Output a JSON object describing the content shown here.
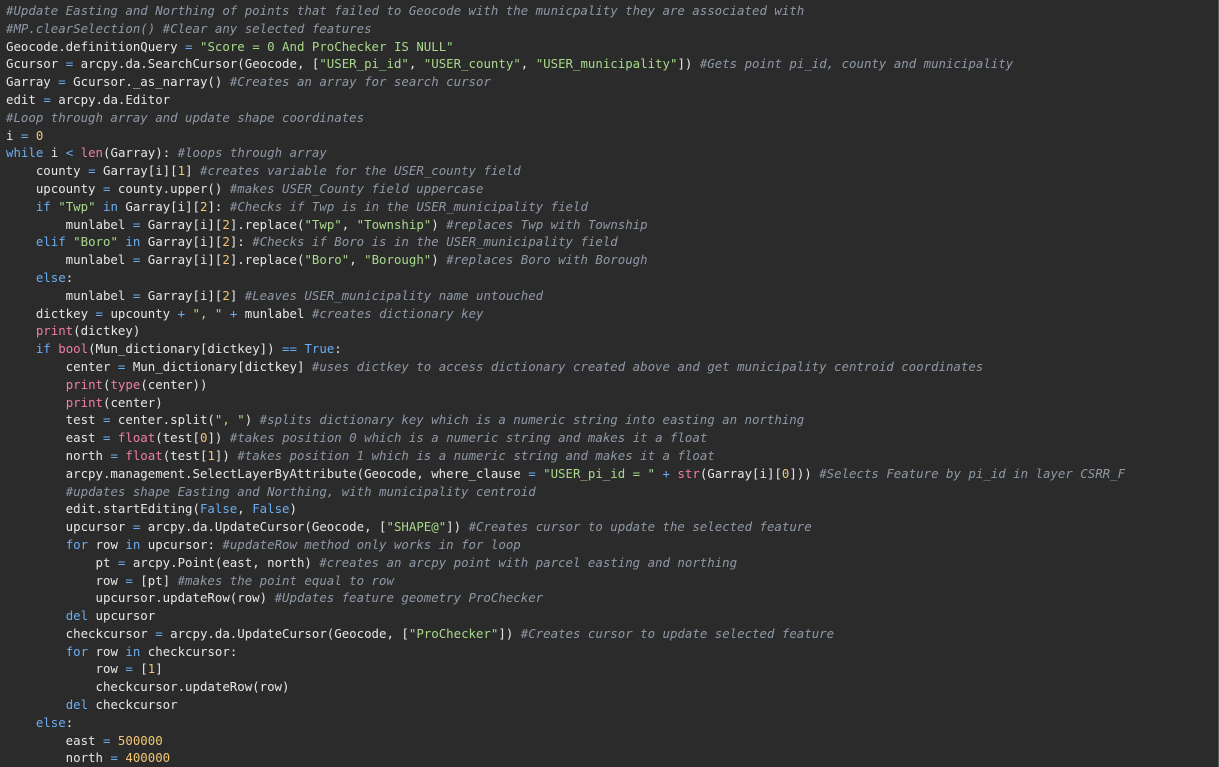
{
  "colors": {
    "background": "#2b2b2b",
    "text": "#e6e6e6",
    "comment": "#8f98a6",
    "string": "#a8d98a",
    "keyword": "#6aaef2",
    "builtin": "#ef7ea8",
    "number": "#f0c674",
    "operator": "#6aaef2"
  },
  "editor": {
    "lines": [
      [
        [
          "comment",
          "#Update Easting and Northing of points that failed to Geocode with the municpality they are associated with"
        ]
      ],
      [
        [
          "comment",
          "#MP.clearSelection() #Clear any selected features"
        ]
      ],
      [
        [
          "text",
          "Geocode.definitionQuery "
        ],
        [
          "operator",
          "="
        ],
        [
          "text",
          " "
        ],
        [
          "string",
          "\"Score = 0 And ProChecker IS NULL\""
        ]
      ],
      [
        [
          "text",
          "Gcursor "
        ],
        [
          "operator",
          "="
        ],
        [
          "text",
          " arcpy.da.SearchCursor(Geocode, ["
        ],
        [
          "string",
          "\"USER_pi_id\""
        ],
        [
          "text",
          ", "
        ],
        [
          "string",
          "\"USER_county\""
        ],
        [
          "text",
          ", "
        ],
        [
          "string",
          "\"USER_municipality\""
        ],
        [
          "text",
          "]) "
        ],
        [
          "comment",
          "#Gets point pi_id, county and municipality"
        ]
      ],
      [
        [
          "text",
          "Garray "
        ],
        [
          "operator",
          "="
        ],
        [
          "text",
          " Gcursor._as_narray() "
        ],
        [
          "comment",
          "#Creates an array for search cursor"
        ]
      ],
      [
        [
          "text",
          "edit "
        ],
        [
          "operator",
          "="
        ],
        [
          "text",
          " arcpy.da.Editor"
        ]
      ],
      [
        [
          "comment",
          "#Loop through array and update shape coordinates"
        ]
      ],
      [
        [
          "text",
          "i "
        ],
        [
          "operator",
          "="
        ],
        [
          "text",
          " "
        ],
        [
          "number",
          "0"
        ]
      ],
      [
        [
          "keyword",
          "while"
        ],
        [
          "text",
          " i "
        ],
        [
          "operator",
          "<"
        ],
        [
          "text",
          " "
        ],
        [
          "builtin",
          "len"
        ],
        [
          "text",
          "(Garray): "
        ],
        [
          "comment",
          "#loops through array"
        ]
      ],
      [
        [
          "text",
          "    county "
        ],
        [
          "operator",
          "="
        ],
        [
          "text",
          " Garray[i]["
        ],
        [
          "number",
          "1"
        ],
        [
          "text",
          "] "
        ],
        [
          "comment",
          "#creates variable for the USER_county field"
        ]
      ],
      [
        [
          "text",
          "    upcounty "
        ],
        [
          "operator",
          "="
        ],
        [
          "text",
          " county.upper() "
        ],
        [
          "comment",
          "#makes USER_County field uppercase"
        ]
      ],
      [
        [
          "text",
          "    "
        ],
        [
          "keyword",
          "if"
        ],
        [
          "text",
          " "
        ],
        [
          "string",
          "\"Twp\""
        ],
        [
          "text",
          " "
        ],
        [
          "keyword",
          "in"
        ],
        [
          "text",
          " Garray[i]["
        ],
        [
          "number",
          "2"
        ],
        [
          "text",
          "]: "
        ],
        [
          "comment",
          "#Checks if Twp is in the USER_municipality field"
        ]
      ],
      [
        [
          "text",
          "        munlabel "
        ],
        [
          "operator",
          "="
        ],
        [
          "text",
          " Garray[i]["
        ],
        [
          "number",
          "2"
        ],
        [
          "text",
          "].replace("
        ],
        [
          "string",
          "\"Twp\""
        ],
        [
          "text",
          ", "
        ],
        [
          "string",
          "\"Township\""
        ],
        [
          "text",
          ") "
        ],
        [
          "comment",
          "#replaces Twp with Township"
        ]
      ],
      [
        [
          "text",
          "    "
        ],
        [
          "keyword",
          "elif"
        ],
        [
          "text",
          " "
        ],
        [
          "string",
          "\"Boro\""
        ],
        [
          "text",
          " "
        ],
        [
          "keyword",
          "in"
        ],
        [
          "text",
          " Garray[i]["
        ],
        [
          "number",
          "2"
        ],
        [
          "text",
          "]: "
        ],
        [
          "comment",
          "#Checks if Boro is in the USER_municipality field"
        ]
      ],
      [
        [
          "text",
          "        munlabel "
        ],
        [
          "operator",
          "="
        ],
        [
          "text",
          " Garray[i]["
        ],
        [
          "number",
          "2"
        ],
        [
          "text",
          "].replace("
        ],
        [
          "string",
          "\"Boro\""
        ],
        [
          "text",
          ", "
        ],
        [
          "string",
          "\"Borough\""
        ],
        [
          "text",
          ") "
        ],
        [
          "comment",
          "#replaces Boro with Borough"
        ]
      ],
      [
        [
          "text",
          "    "
        ],
        [
          "keyword",
          "else"
        ],
        [
          "text",
          ":"
        ]
      ],
      [
        [
          "text",
          "        munlabel "
        ],
        [
          "operator",
          "="
        ],
        [
          "text",
          " Garray[i]["
        ],
        [
          "number",
          "2"
        ],
        [
          "text",
          "] "
        ],
        [
          "comment",
          "#Leaves USER_municipality name untouched"
        ]
      ],
      [
        [
          "text",
          "    dictkey "
        ],
        [
          "operator",
          "="
        ],
        [
          "text",
          " upcounty "
        ],
        [
          "operator",
          "+"
        ],
        [
          "text",
          " "
        ],
        [
          "string",
          "\", \""
        ],
        [
          "text",
          " "
        ],
        [
          "operator",
          "+"
        ],
        [
          "text",
          " munlabel "
        ],
        [
          "comment",
          "#creates dictionary key"
        ]
      ],
      [
        [
          "text",
          "    "
        ],
        [
          "builtin",
          "print"
        ],
        [
          "text",
          "(dictkey)"
        ]
      ],
      [
        [
          "text",
          "    "
        ],
        [
          "keyword",
          "if"
        ],
        [
          "text",
          " "
        ],
        [
          "builtin",
          "bool"
        ],
        [
          "text",
          "(Mun_dictionary[dictkey]) "
        ],
        [
          "operator",
          "=="
        ],
        [
          "text",
          " "
        ],
        [
          "keyword",
          "True"
        ],
        [
          "text",
          ":"
        ]
      ],
      [
        [
          "text",
          "        center "
        ],
        [
          "operator",
          "="
        ],
        [
          "text",
          " Mun_dictionary[dictkey] "
        ],
        [
          "comment",
          "#uses dictkey to access dictionary created above and get municipality centroid coordinates"
        ]
      ],
      [
        [
          "text",
          "        "
        ],
        [
          "builtin",
          "print"
        ],
        [
          "text",
          "("
        ],
        [
          "builtin",
          "type"
        ],
        [
          "text",
          "(center))"
        ]
      ],
      [
        [
          "text",
          "        "
        ],
        [
          "builtin",
          "print"
        ],
        [
          "text",
          "(center)"
        ]
      ],
      [
        [
          "text",
          "        test "
        ],
        [
          "operator",
          "="
        ],
        [
          "text",
          " center.split("
        ],
        [
          "string",
          "\", \""
        ],
        [
          "text",
          ") "
        ],
        [
          "comment",
          "#splits dictionary key which is a numeric string into easting an northing"
        ]
      ],
      [
        [
          "text",
          "        east "
        ],
        [
          "operator",
          "="
        ],
        [
          "text",
          " "
        ],
        [
          "builtin",
          "float"
        ],
        [
          "text",
          "(test["
        ],
        [
          "number",
          "0"
        ],
        [
          "text",
          "]) "
        ],
        [
          "comment",
          "#takes position 0 which is a numeric string and makes it a float"
        ]
      ],
      [
        [
          "text",
          "        north "
        ],
        [
          "operator",
          "="
        ],
        [
          "text",
          " "
        ],
        [
          "builtin",
          "float"
        ],
        [
          "text",
          "(test["
        ],
        [
          "number",
          "1"
        ],
        [
          "text",
          "]) "
        ],
        [
          "comment",
          "#takes position 1 which is a numeric string and makes it a float"
        ]
      ],
      [
        [
          "text",
          "        arcpy.management.SelectLayerByAttribute(Geocode, where_clause "
        ],
        [
          "operator",
          "="
        ],
        [
          "text",
          " "
        ],
        [
          "string",
          "\"USER_pi_id = \""
        ],
        [
          "text",
          " "
        ],
        [
          "operator",
          "+"
        ],
        [
          "text",
          " "
        ],
        [
          "builtin",
          "str"
        ],
        [
          "text",
          "(Garray[i]["
        ],
        [
          "number",
          "0"
        ],
        [
          "text",
          "])) "
        ],
        [
          "comment",
          "#Selects Feature by pi_id in layer CSRR_F"
        ]
      ],
      [
        [
          "text",
          "        "
        ],
        [
          "comment",
          "#updates shape Easting and Northing, with municipality centroid"
        ]
      ],
      [
        [
          "text",
          "        edit.startEditing("
        ],
        [
          "keyword",
          "False"
        ],
        [
          "text",
          ", "
        ],
        [
          "keyword",
          "False"
        ],
        [
          "text",
          ")"
        ]
      ],
      [
        [
          "text",
          "        upcursor "
        ],
        [
          "operator",
          "="
        ],
        [
          "text",
          " arcpy.da.UpdateCursor(Geocode, ["
        ],
        [
          "string",
          "\"SHAPE@\""
        ],
        [
          "text",
          "]) "
        ],
        [
          "comment",
          "#Creates cursor to update the selected feature"
        ]
      ],
      [
        [
          "text",
          "        "
        ],
        [
          "keyword",
          "for"
        ],
        [
          "text",
          " row "
        ],
        [
          "keyword",
          "in"
        ],
        [
          "text",
          " upcursor: "
        ],
        [
          "comment",
          "#updateRow method only works in for loop"
        ]
      ],
      [
        [
          "text",
          "            pt "
        ],
        [
          "operator",
          "="
        ],
        [
          "text",
          " arcpy.Point(east, north) "
        ],
        [
          "comment",
          "#creates an arcpy point with parcel easting and northing"
        ]
      ],
      [
        [
          "text",
          "            row "
        ],
        [
          "operator",
          "="
        ],
        [
          "text",
          " [pt] "
        ],
        [
          "comment",
          "#makes the point equal to row"
        ]
      ],
      [
        [
          "text",
          "            upcursor.updateRow(row) "
        ],
        [
          "comment",
          "#Updates feature geometry ProChecker"
        ]
      ],
      [
        [
          "text",
          "        "
        ],
        [
          "keyword",
          "del"
        ],
        [
          "text",
          " upcursor"
        ]
      ],
      [
        [
          "text",
          "        checkcursor "
        ],
        [
          "operator",
          "="
        ],
        [
          "text",
          " arcpy.da.UpdateCursor(Geocode, ["
        ],
        [
          "string",
          "\"ProChecker\""
        ],
        [
          "text",
          "]) "
        ],
        [
          "comment",
          "#Creates cursor to update selected feature"
        ]
      ],
      [
        [
          "text",
          "        "
        ],
        [
          "keyword",
          "for"
        ],
        [
          "text",
          " row "
        ],
        [
          "keyword",
          "in"
        ],
        [
          "text",
          " checkcursor:"
        ]
      ],
      [
        [
          "text",
          "            row "
        ],
        [
          "operator",
          "="
        ],
        [
          "text",
          " ["
        ],
        [
          "number",
          "1"
        ],
        [
          "text",
          "]"
        ]
      ],
      [
        [
          "text",
          "            checkcursor.updateRow(row)"
        ]
      ],
      [
        [
          "text",
          "        "
        ],
        [
          "keyword",
          "del"
        ],
        [
          "text",
          " checkcursor"
        ]
      ],
      [
        [
          "text",
          "    "
        ],
        [
          "keyword",
          "else"
        ],
        [
          "text",
          ":"
        ]
      ],
      [
        [
          "text",
          "        east "
        ],
        [
          "operator",
          "="
        ],
        [
          "text",
          " "
        ],
        [
          "number",
          "500000"
        ]
      ],
      [
        [
          "text",
          "        north "
        ],
        [
          "operator",
          "="
        ],
        [
          "text",
          " "
        ],
        [
          "number",
          "400000"
        ]
      ]
    ]
  }
}
